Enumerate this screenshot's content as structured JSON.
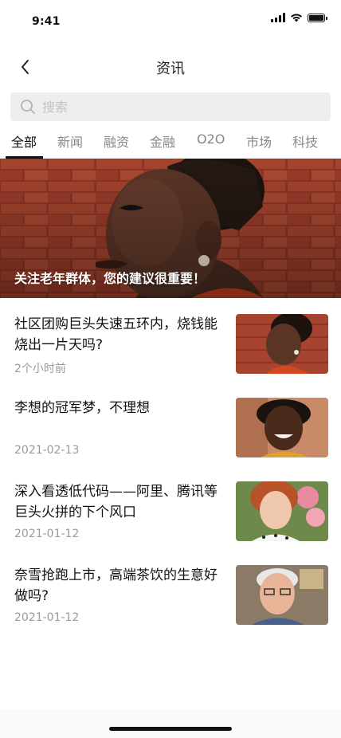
{
  "status_bar": {
    "time": "9:41"
  },
  "nav": {
    "title": "资讯",
    "back_icon": "chevron-left-icon"
  },
  "search": {
    "placeholder": "搜索",
    "value": ""
  },
  "tabs": [
    {
      "label": "全部",
      "active": true
    },
    {
      "label": "新闻",
      "active": false
    },
    {
      "label": "融资",
      "active": false
    },
    {
      "label": "金融",
      "active": false
    },
    {
      "label": "O2O",
      "active": false
    },
    {
      "label": "市场",
      "active": false
    },
    {
      "label": "科技",
      "active": false
    }
  ],
  "banner": {
    "caption": "关注老年群体，您的建议很重要！"
  },
  "news": [
    {
      "title": "社区团购巨头失速五环内，烧钱能烧出一片天吗?",
      "time": "2个小时前"
    },
    {
      "title": "李想的冠军梦，不理想",
      "time": "2021-02-13"
    },
    {
      "title": "深入看透低代码——阿里、腾讯等巨头火拼的下个风口",
      "time": "2021-01-12"
    },
    {
      "title": "奈雪抢跑上市，高端茶饮的生意好做吗?",
      "time": "2021-01-12"
    }
  ],
  "colors": {
    "text": "#111111",
    "muted": "#9a9a9a",
    "search_bg": "#eeeeee",
    "banner_brick": "#a3402f"
  }
}
